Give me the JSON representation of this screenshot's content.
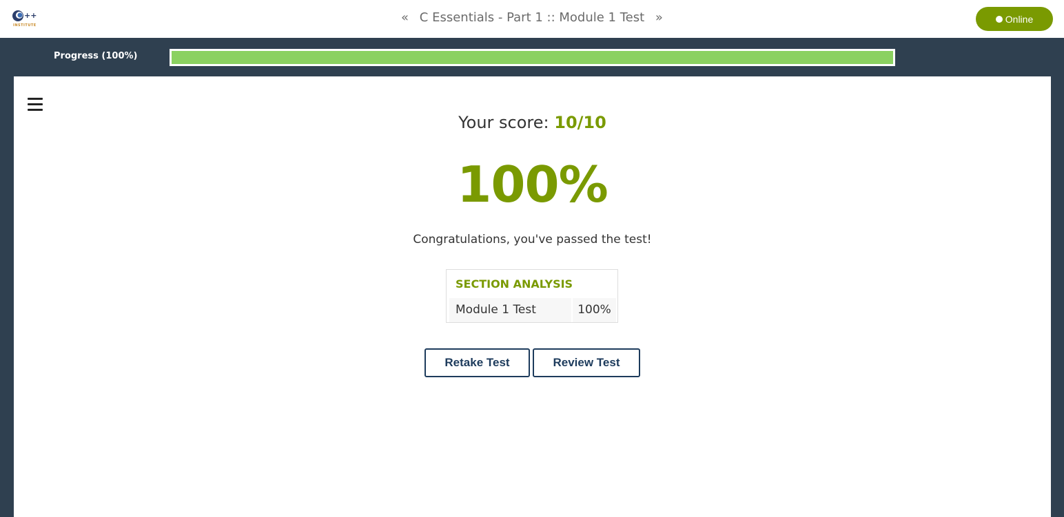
{
  "header": {
    "logo_icon": "cpp-institute-logo",
    "logo_caption": "INSTITUTE",
    "prev_icon": "double-chevron-left-icon",
    "title": "C Essentials - Part 1 :: Module 1 Test",
    "next_icon": "double-chevron-right-icon",
    "status_label": "Online"
  },
  "progress": {
    "label": "Progress (100%)",
    "value_percent": 100
  },
  "main": {
    "menu_icon": "hamburger-menu-icon",
    "score_prefix": "Your score: ",
    "score_value": "10/10",
    "percent": "100%",
    "message": "Congratulations, you've passed the test!",
    "analysis": {
      "title": "SECTION ANALYSIS",
      "rows": [
        {
          "name": "Module 1 Test",
          "value": "100%"
        }
      ]
    },
    "buttons": {
      "retake": "Retake Test",
      "review": "Review Test"
    }
  },
  "colors": {
    "accent": "#7a9a01",
    "progress_fill": "#8bd160",
    "frame": "#2f4050",
    "button_border": "#1d3b5c"
  }
}
